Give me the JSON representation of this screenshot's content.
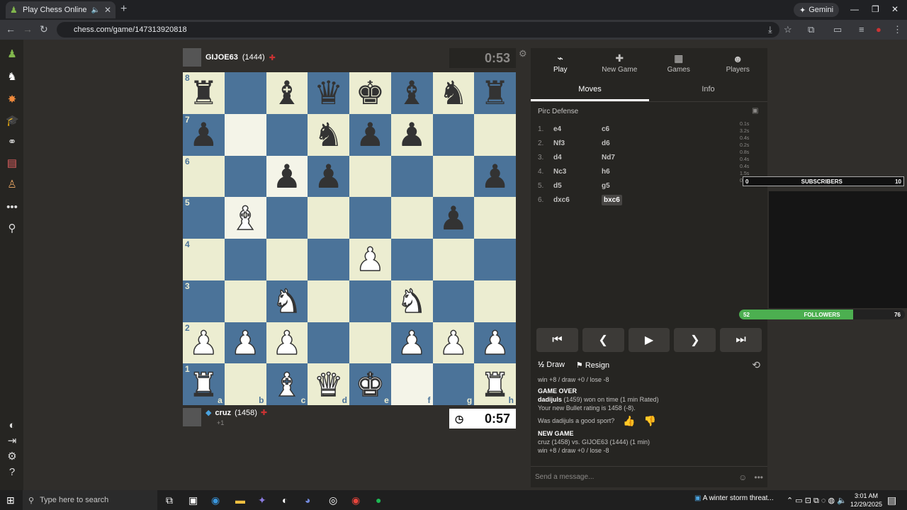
{
  "browser": {
    "tab_title": "Play Chess Online for FREE",
    "url": "chess.com/game/147313920818",
    "gemini_label": "Gemini"
  },
  "top_player": {
    "name": "GIJOE63",
    "rating": "(1444)",
    "clock": "0:53"
  },
  "bottom_player": {
    "name": "cruz",
    "rating": "(1458)",
    "sub": "+1",
    "clock": "0:57"
  },
  "board": {
    "ranks": [
      "8",
      "7",
      "6",
      "5",
      "4",
      "3",
      "2",
      "1"
    ],
    "files": [
      "a",
      "b",
      "c",
      "d",
      "e",
      "f",
      "g",
      "h"
    ],
    "squares": [
      [
        "br",
        "",
        "bb",
        "bq",
        "bk",
        "bb",
        "bn",
        "br"
      ],
      [
        "bp",
        "",
        "",
        "bn",
        "bp",
        "bp",
        "",
        ""
      ],
      [
        "",
        "",
        "bp",
        "bp",
        "",
        "",
        "",
        "bp"
      ],
      [
        "",
        "wb",
        "",
        "",
        "",
        "",
        "bp",
        ""
      ],
      [
        "",
        "",
        "",
        "",
        "wp",
        "",
        "",
        ""
      ],
      [
        "",
        "",
        "wn",
        "",
        "",
        "wn",
        "",
        ""
      ],
      [
        "wp",
        "wp",
        "wp",
        "",
        "",
        "wp",
        "wp",
        "wp"
      ],
      [
        "wr",
        "",
        "wb",
        "wq",
        "wk",
        "",
        "",
        "wr"
      ]
    ],
    "highlighted": [
      "b7",
      "b5",
      "c6",
      "f1"
    ]
  },
  "panel": {
    "tabs": [
      {
        "label": "Play",
        "icon": "play-icon"
      },
      {
        "label": "New Game",
        "icon": "plus-icon"
      },
      {
        "label": "Games",
        "icon": "games-icon"
      },
      {
        "label": "Players",
        "icon": "players-icon"
      }
    ],
    "subtabs": [
      "Moves",
      "Info"
    ],
    "opening": "Pirc Defense",
    "moves": [
      {
        "num": "1.",
        "white": "e4",
        "black": "c6"
      },
      {
        "num": "2.",
        "white": "Nf3",
        "black": "d6"
      },
      {
        "num": "3.",
        "white": "d4",
        "black": "Nd7"
      },
      {
        "num": "4.",
        "white": "Nc3",
        "black": "h6"
      },
      {
        "num": "5.",
        "white": "d5",
        "black": "g5"
      },
      {
        "num": "6.",
        "white": "dxc6",
        "black": "bxc6"
      }
    ],
    "times": [
      "0.1s",
      "3.2s",
      "0.4s",
      "0.2s",
      "0.8s",
      "0.4s",
      "0.4s",
      "1.5s",
      "0.1s"
    ],
    "draw_label": "Draw",
    "resign_label": "Resign",
    "chat": {
      "line1": "win +8 / draw +0 / lose -8",
      "game_over": "GAME OVER",
      "result_name": "dadijuls",
      "result_rest": "(1459) won on time (1 min Rated)",
      "rating_line": "Your new Bullet rating is 1458 (-8).",
      "sport_q": "Was dadijuls a good sport?",
      "new_game": "NEW GAME",
      "new_game_line": "cruz (1458) vs. GIJOE63 (1444) (1 min)",
      "line_last": "win +8 / draw +0 / lose -8"
    },
    "message_placeholder": "Send a message..."
  },
  "overlay": {
    "subscribers_left": "0",
    "subscribers_label": "SUBSCRIBERS",
    "subscribers_goal": "10",
    "followers_left": "52",
    "followers_label": "FOLLOWERS",
    "followers_goal": "76",
    "followers_progress": 0.69
  },
  "taskbar": {
    "search_placeholder": "Type here to search",
    "news": "A winter storm threat...",
    "time": "3:01 AM",
    "date": "12/29/2025"
  },
  "colors": {
    "board_light": "#ecedd1",
    "board_dark": "#4b7399",
    "highlight": "#a8d8ea",
    "accent_green": "#81b64c"
  }
}
